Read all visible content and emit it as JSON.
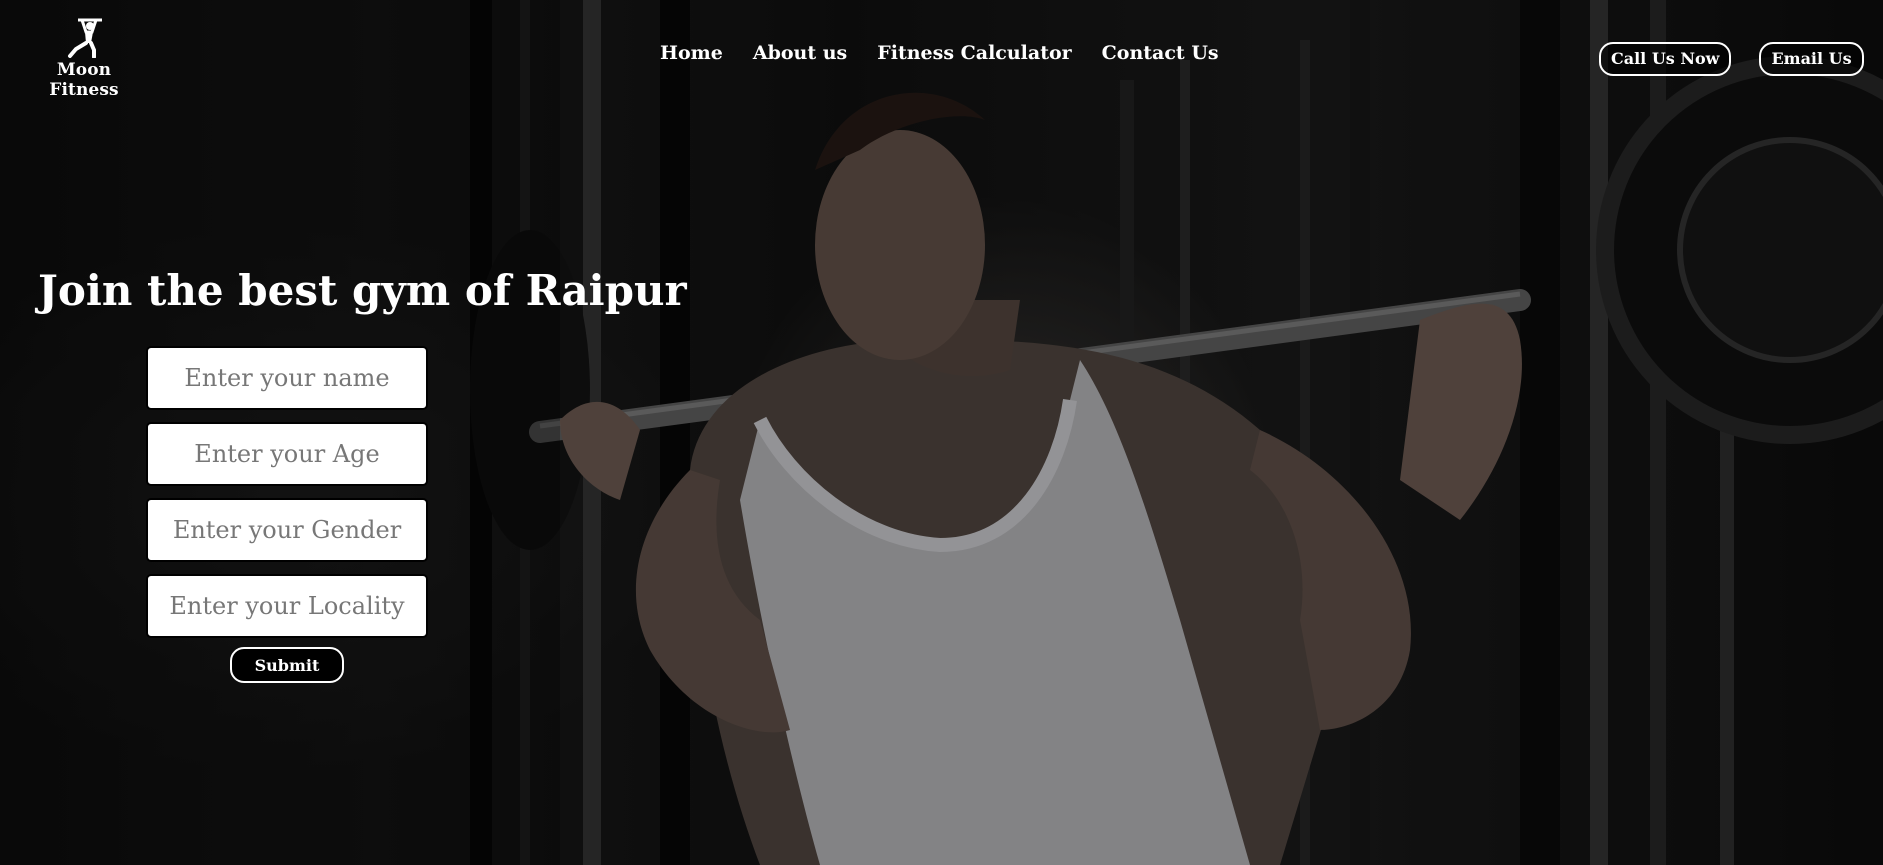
{
  "brand": {
    "name": "Moon Fitness",
    "logo_icon": "weightlifter-icon"
  },
  "nav": {
    "items": [
      {
        "label": "Home"
      },
      {
        "label": "About us"
      },
      {
        "label": "Fitness Calculator"
      },
      {
        "label": "Contact Us"
      }
    ]
  },
  "contact": {
    "call_label": "Call Us Now",
    "email_label": "Email Us"
  },
  "hero": {
    "headline": "Join the best gym of Raipur"
  },
  "form": {
    "name_placeholder": "Enter your name",
    "age_placeholder": "Enter your Age",
    "gender_placeholder": "Enter your Gender",
    "locality_placeholder": "Enter your Locality",
    "submit_label": "Submit"
  },
  "colors": {
    "text": "#ffffff",
    "button_bg": "#000000",
    "field_bg": "#ffffff"
  }
}
